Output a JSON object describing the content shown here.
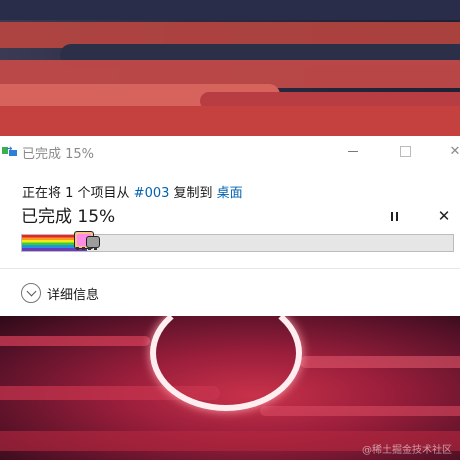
{
  "window": {
    "title": "已完成 15%"
  },
  "copy_status": {
    "prefix": "正在将 1 个项目从 ",
    "source": "#003",
    "middle": " 复制到 ",
    "destination": "桌面"
  },
  "progress": {
    "label": "已完成 15%",
    "fraction": 0.15
  },
  "controls": {
    "pause_icon": "pause-icon",
    "cancel_glyph": "✕",
    "close_glyph": "✕"
  },
  "details": {
    "label": "详细信息"
  },
  "watermark": "@稀土掘金技术社区",
  "colors": {
    "link": "#0063b1"
  }
}
